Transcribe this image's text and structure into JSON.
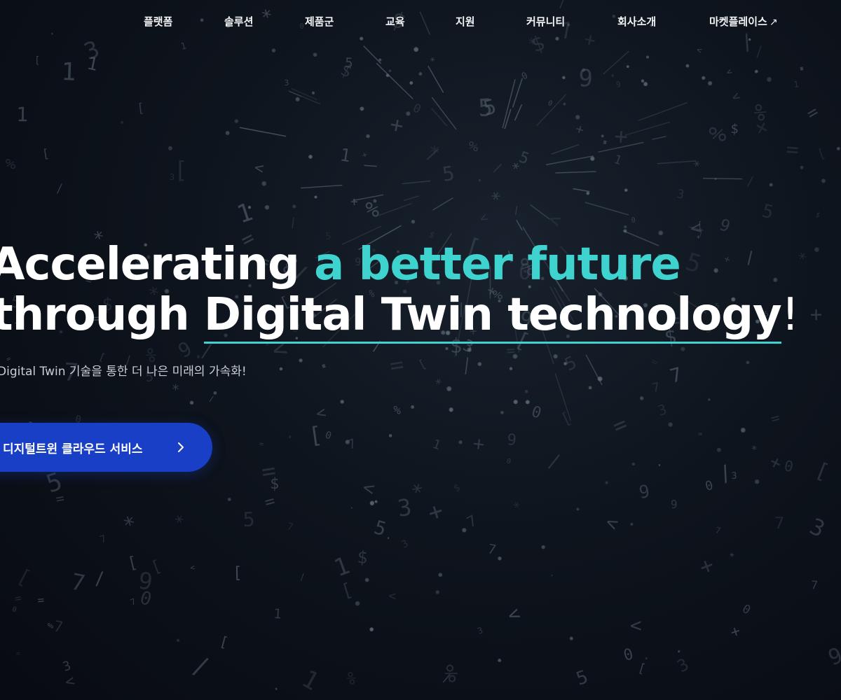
{
  "nav": {
    "items": [
      {
        "label": "플랫폼"
      },
      {
        "label": "솔루션"
      },
      {
        "label": "제품군"
      },
      {
        "label": "교육"
      },
      {
        "label": "지원"
      },
      {
        "label": "커뮤니티"
      },
      {
        "label": "회사소개"
      },
      {
        "label": "마켓플레이스",
        "icon": "external-link-arrow-icon"
      }
    ]
  },
  "hero": {
    "line1_prefix": "Accelerating",
    "line1_accent": "a better future",
    "line2_prefix": "through",
    "line2_underlined": "Digital Twin technology",
    "line2_suffix": "!",
    "subtitle": "Digital Twin 기술을 통한 더 나은 미래의 가속화!"
  },
  "cta": {
    "label": "디지털트윈 클라우드 서비스",
    "icon": "chevron-right-icon"
  },
  "colors": {
    "background": "#0a0d14",
    "accent": "#3fd3cf",
    "cta": "#1a3fc7",
    "text": "#ffffff"
  }
}
